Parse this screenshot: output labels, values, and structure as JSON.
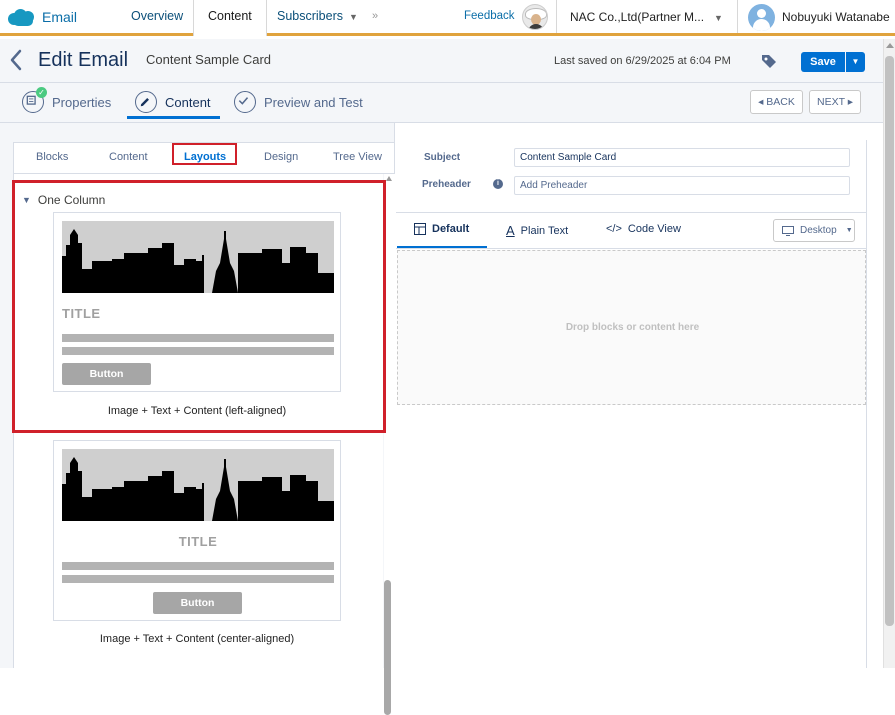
{
  "topnav": {
    "app_name": "Email",
    "tabs": [
      {
        "label": "Overview"
      },
      {
        "label": "Content"
      },
      {
        "label": "Subscribers"
      }
    ],
    "more_glyph": "»",
    "feedback": "Feedback",
    "org_name": "NAC Co.,Ltd(Partner M...",
    "user_name": "Nobuyuki Watanabe",
    "accent_color": "#e0a33d"
  },
  "header": {
    "title": "Edit Email",
    "subtitle": "Content Sample Card",
    "last_saved": "Last saved on 6/29/2025 at 6:04 PM",
    "save_label": "Save"
  },
  "steps": {
    "items": [
      {
        "label": "Properties",
        "icon": "properties-icon",
        "complete": true
      },
      {
        "label": "Content",
        "icon": "pencil-icon",
        "active": true
      },
      {
        "label": "Preview and Test",
        "icon": "check-circle-icon"
      }
    ],
    "back_label": "BACK",
    "next_label": "NEXT"
  },
  "left_panel": {
    "tabs": [
      {
        "label": "Blocks"
      },
      {
        "label": "Content"
      },
      {
        "label": "Layouts",
        "active": true
      },
      {
        "label": "Design"
      },
      {
        "label": "Tree View"
      }
    ],
    "section_title": "One Column",
    "cards": [
      {
        "title": "TITLE",
        "button": "Button",
        "caption": "Image + Text + Content (left-aligned)",
        "align": "left"
      },
      {
        "title": "TITLE",
        "button": "Button",
        "caption": "Image + Text + Content (center-aligned)",
        "align": "center"
      }
    ]
  },
  "right_panel": {
    "subject_label": "Subject",
    "subject_value": "Content Sample Card",
    "preheader_label": "Preheader",
    "preheader_placeholder": "Add Preheader",
    "view_tabs": [
      {
        "label": "Default",
        "active": true
      },
      {
        "label": "Plain Text"
      },
      {
        "label": "Code View"
      }
    ],
    "device": "Desktop",
    "dropzone_text": "Drop blocks or content here"
  },
  "colors": {
    "primary": "#0070d2",
    "highlight": "#d0202a"
  }
}
